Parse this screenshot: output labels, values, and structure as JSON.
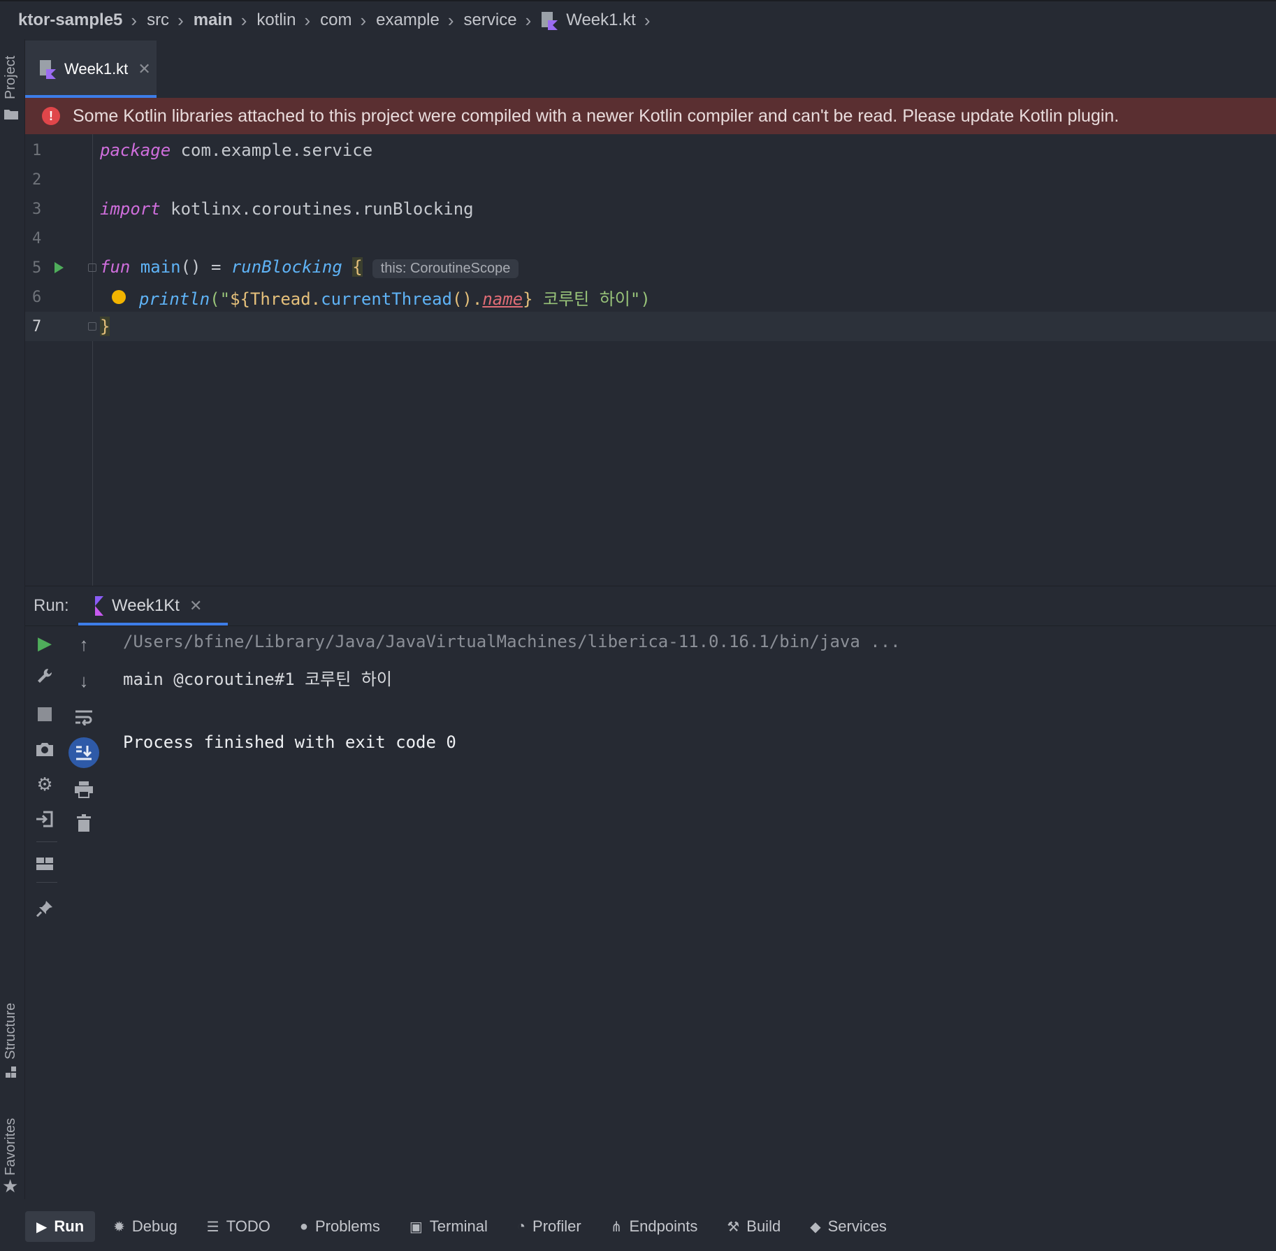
{
  "breadcrumb": {
    "items": [
      "ktor-sample5",
      "src",
      "main",
      "kotlin",
      "com",
      "example",
      "service",
      "Week1.kt"
    ]
  },
  "side_labels": {
    "project": "Project",
    "structure": "Structure",
    "favorites": "Favorites"
  },
  "editor_tab": {
    "label": "Week1.kt"
  },
  "error_banner": {
    "message": "Some Kotlin libraries attached to this project were compiled with a newer Kotlin compiler and can't be read. Please update Kotlin plugin."
  },
  "code": {
    "line_numbers": [
      "1",
      "2",
      "3",
      "4",
      "5",
      "6",
      "7"
    ],
    "l1_kw": "package",
    "l1_rest": " com.example.service",
    "l3_kw": "import",
    "l3_rest": " kotlinx.coroutines.runBlocking",
    "l5_kw": "fun",
    "l5_fn": " main",
    "l5_mid": "() = ",
    "l5_call": "runBlocking",
    "l5_brace": "{",
    "l5_hint": "this: CoroutineScope",
    "l6_call": "println",
    "l6_str_open": "(\"",
    "l6_tmpl_open": "${",
    "l6_thread": "Thread.",
    "l6_ct": "currentThread",
    "l6_paren": "().",
    "l6_prop": "name",
    "l6_tmpl_close": "}",
    "l6_str_rest": " 코루틴 하이",
    "l6_close": "\")",
    "l7_brace": "}"
  },
  "run_panel": {
    "label": "Run:",
    "tab_label": "Week1Kt",
    "console_lines": [
      "/Users/bfine/Library/Java/JavaVirtualMachines/liberica-11.0.16.1/bin/java ...",
      "main @coroutine#1 코루틴 하이",
      "Process finished with exit code 0"
    ]
  },
  "bottom_bar": {
    "buttons": [
      "Run",
      "Debug",
      "TODO",
      "Problems",
      "Terminal",
      "Profiler",
      "Endpoints",
      "Build",
      "Services"
    ]
  },
  "colors": {
    "accent": "#3d7de8",
    "error_bg": "#5a2f31",
    "run_green": "#4fad5b",
    "keyword": "#cf6edc"
  }
}
